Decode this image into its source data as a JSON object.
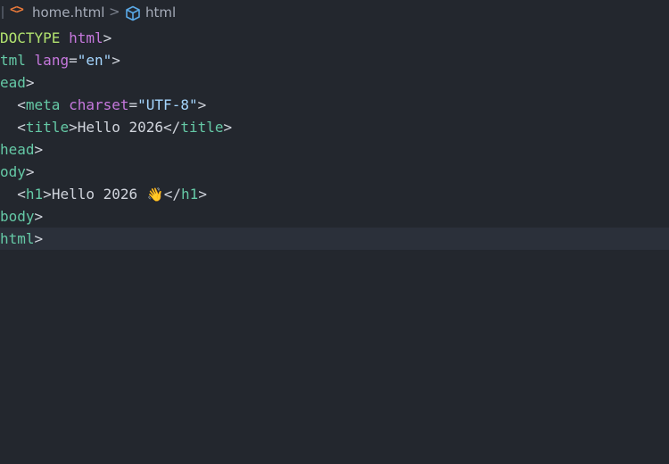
{
  "breadcrumb": {
    "file_icon": "<>",
    "file": "home.html",
    "separator": ">",
    "symbol_icon": "cube-icon",
    "symbol": "html"
  },
  "code": {
    "lines": [
      {
        "parts": [
          "DOCTYPE",
          "html",
          ">"
        ]
      },
      {
        "parts": [
          "tml",
          "lang",
          "=",
          "\"en\"",
          ">"
        ]
      },
      {
        "parts": [
          "ead",
          ">"
        ]
      },
      {
        "parts": [
          "  ",
          "<",
          "meta",
          "charset",
          "=",
          "\"UTF-8\"",
          ">"
        ]
      },
      {
        "parts": [
          "  ",
          "<",
          "title",
          ">",
          "Hello 2026",
          "</",
          "title",
          ">"
        ]
      },
      {
        "parts": [
          "head",
          ">"
        ]
      },
      {
        "parts": [
          "ody",
          ">"
        ]
      },
      {
        "parts": [
          "  ",
          "<",
          "h1",
          ">",
          "Hello 2026 ",
          "👋",
          "</",
          "h1",
          ">"
        ]
      },
      {
        "parts": [
          "body",
          ">"
        ]
      },
      {
        "parts": [
          "html",
          ">"
        ]
      }
    ]
  },
  "colors": {
    "background": "#23272e",
    "current_line": "#2b303a",
    "tag": "#65c9a6",
    "attribute": "#c678dd",
    "string": "#a5d6ff",
    "doctype": "#b2e36f",
    "text": "#d0d4dc",
    "file_icon": "#e8793a",
    "symbol_icon": "#5aa9e6"
  }
}
